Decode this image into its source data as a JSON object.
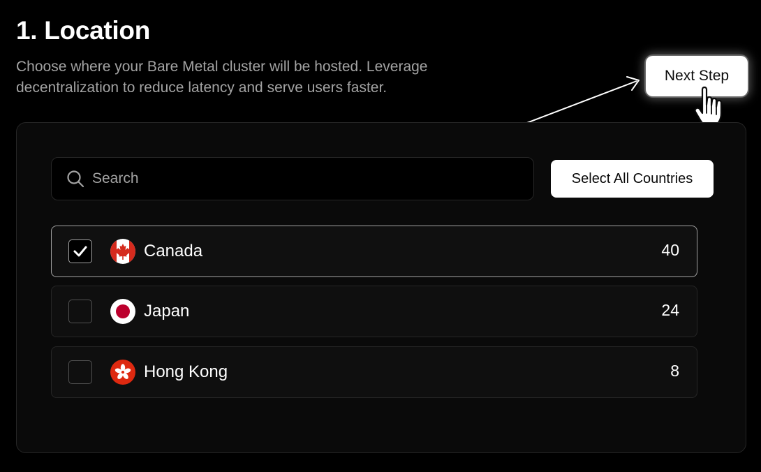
{
  "header": {
    "title": "1. Location",
    "subtitle": "Choose where your Bare Metal cluster will be hosted. Leverage decentralization to reduce latency and serve users faster."
  },
  "actions": {
    "next_label": "Next Step"
  },
  "search": {
    "placeholder": "Search",
    "value": ""
  },
  "select_all_label": "Select All Countries",
  "countries": [
    {
      "name": "Canada",
      "count": "40",
      "selected": true,
      "flag": "canada-flag-icon"
    },
    {
      "name": "Japan",
      "count": "24",
      "selected": false,
      "flag": "japan-flag-icon"
    },
    {
      "name": "Hong Kong",
      "count": "8",
      "selected": false,
      "flag": "hong-kong-flag-icon"
    }
  ],
  "colors": {
    "background": "#000000",
    "panel": "#0a0a0a",
    "border": "#262626",
    "muted_text": "#a3a3a3",
    "button_bg": "#ffffff",
    "canada_red": "#d52b1e",
    "japan_red": "#bc002d",
    "hong_kong_red": "#de2910"
  }
}
